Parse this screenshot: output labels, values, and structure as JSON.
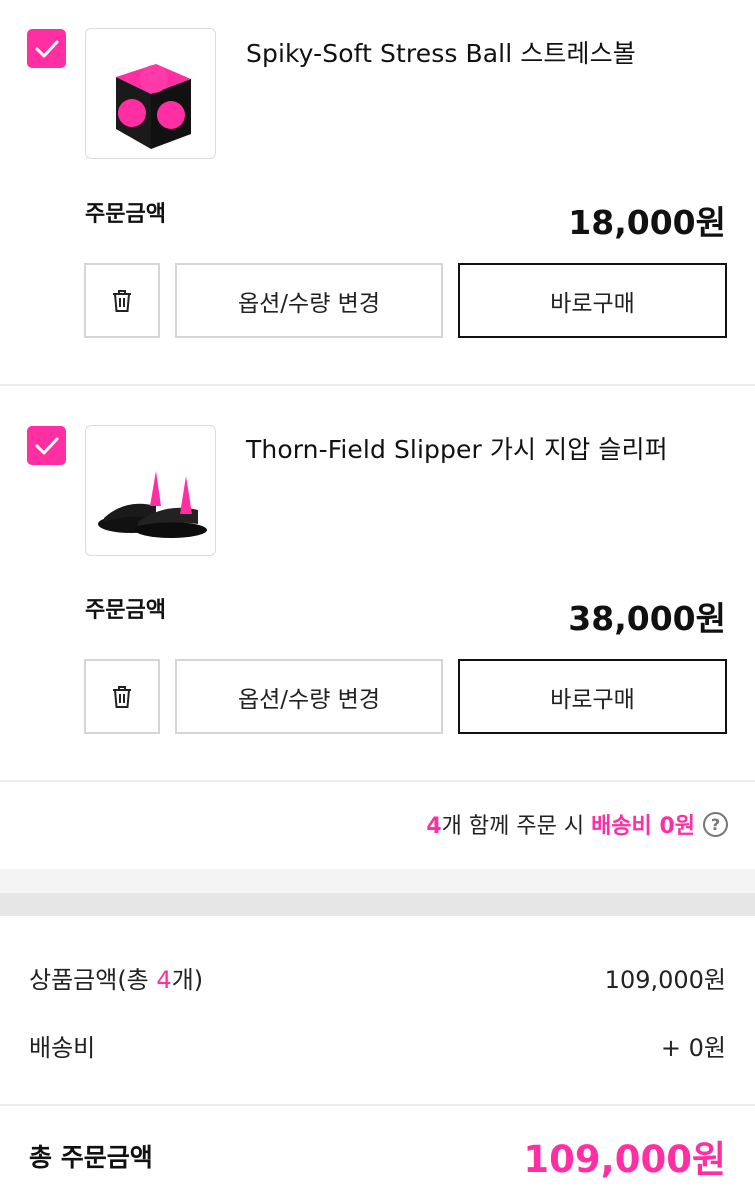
{
  "items": [
    {
      "name": "Spiky-Soft Stress Ball 스트레스볼",
      "checked": true,
      "order_label": "주문금액",
      "order_price": "18,000원",
      "thumb_icon": "stress-ball-cube-image",
      "option_button": "옵션/수량 변경",
      "buy_button": "바로구매"
    },
    {
      "name": "Thorn-Field Slipper 가시 지압 슬리퍼",
      "checked": true,
      "order_label": "주문금액",
      "order_price": "38,000원",
      "thumb_icon": "spiked-slipper-image",
      "option_button": "옵션/수량 변경",
      "buy_button": "바로구매"
    }
  ],
  "shipping_note": {
    "count": "4",
    "text1": "개 함께 주문 시 ",
    "highlight": "배송비 0원",
    "help_icon": "question-circle-icon"
  },
  "summary": {
    "products_label_pre": "상품금액(총 ",
    "products_count": "4",
    "products_label_post": "개)",
    "products_value": "109,000원",
    "shipping_label": "배송비",
    "shipping_value": "+ 0원",
    "total_label": "총 주문금액",
    "total_value": "109,000원"
  },
  "colors": {
    "accent": "#ff2fa3",
    "border": "#d5d5d5",
    "band": "#e6e6e6"
  }
}
